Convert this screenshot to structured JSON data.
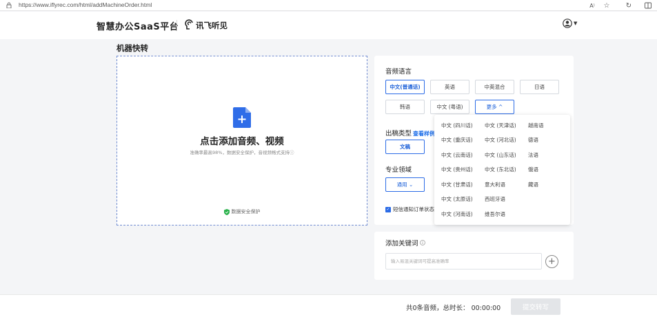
{
  "browser": {
    "url": "https://www.iflyrec.com/html/addMachineOrder.html",
    "icons": [
      "lock-icon",
      "read-aloud-icon",
      "favorite-star-icon",
      "refresh-icon",
      "split-screen-icon"
    ]
  },
  "header": {
    "brand": "智慧办公SaaS平台",
    "partner_logo": "讯飞听见"
  },
  "page": {
    "title": "机器快转"
  },
  "upload": {
    "title": "点击添加音频、视频",
    "subtitle": "准确率最高98%，数据安全保护，音视频格式支持ⓘ",
    "secure_label": "数据安全保护"
  },
  "settings": {
    "audio_language": {
      "label": "音频语言",
      "options": [
        "中文(普通话)",
        "英语",
        "中英混合",
        "日语",
        "韩语",
        "中文 (粤语)"
      ],
      "selected": "中文(普通话)",
      "more_label": "更多 ^"
    },
    "output_type": {
      "label": "出稿类型",
      "link": "查看样例",
      "value": "文稿"
    },
    "domain": {
      "label": "专业领域",
      "value": "通用 ⌄"
    },
    "sms_option": {
      "label": "短信通知订单状态",
      "checked": true
    }
  },
  "more_languages": [
    "中文 (四川话)",
    "中文 (天津话)",
    "越南语",
    "中文 (重庆话)",
    "中文 (河北话)",
    "德语",
    "中文 (云南话)",
    "中文 (山东话)",
    "法语",
    "中文 (贵州话)",
    "中文 (东北话)",
    "俄语",
    "中文 (甘肃话)",
    "意大利语",
    "藏语",
    "中文 (太原话)",
    "西班牙语",
    "中文 (河南话)",
    "维吾尔语"
  ],
  "keywords": {
    "title": "添加关键词",
    "placeholder": "输入易混关键词可提高准确率"
  },
  "footer": {
    "summary": "共0条音频，总时长： 00:00:00",
    "submit_label": "提交转写"
  },
  "colors": {
    "accent": "#2b6be6",
    "upload_border": "#6f8bd0",
    "secure_green": "#2bb24c"
  }
}
